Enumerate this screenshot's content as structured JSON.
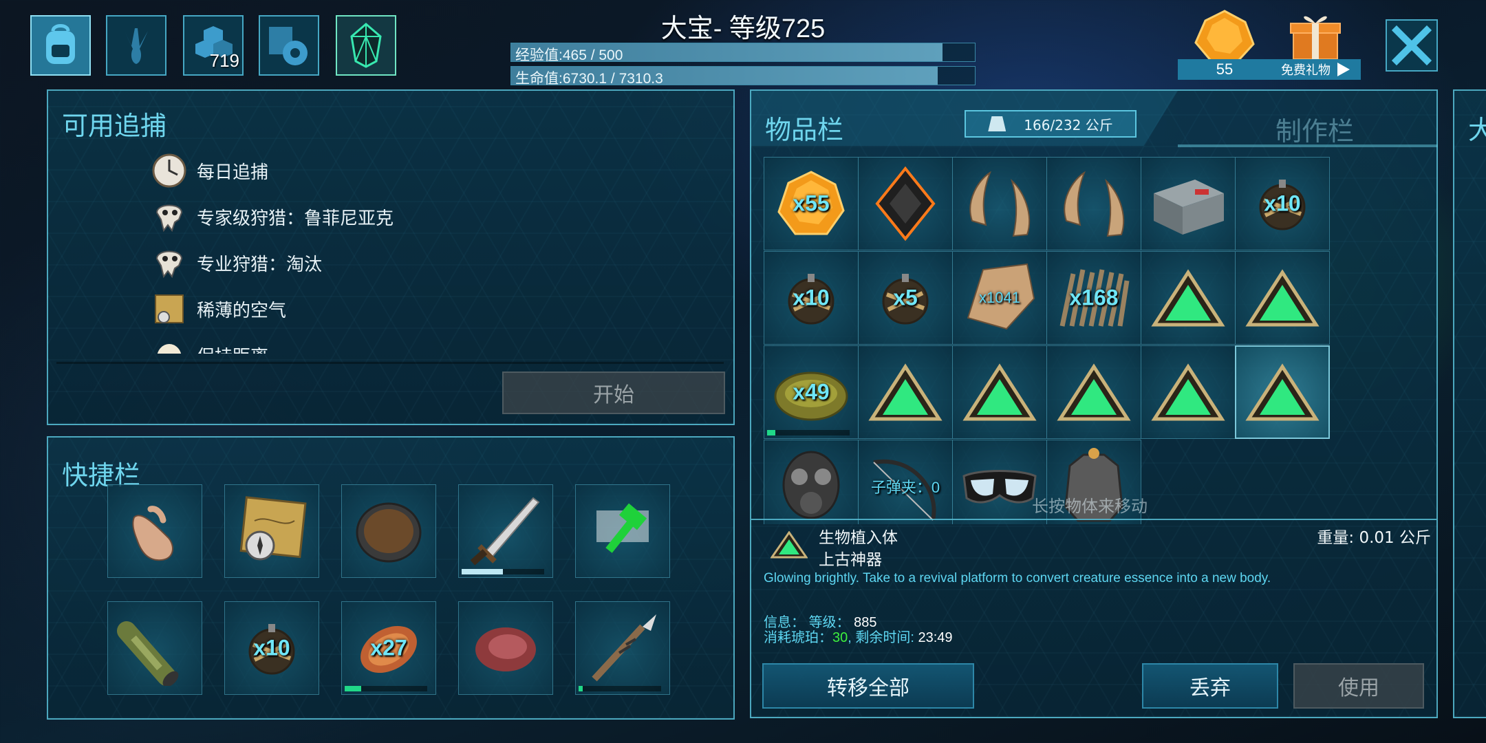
{
  "header": {
    "title": "大宝- 等级725",
    "xp_text": "经验值:465 / 500",
    "xp_fraction": 0.93,
    "health_text": "生命值:6730.1 / 7310.3",
    "health_fraction": 0.92,
    "top_buttons": [
      {
        "icon": "backpack-icon"
      },
      {
        "icon": "dino-footprint-icon"
      },
      {
        "icon": "engrams-icon",
        "label": "719"
      },
      {
        "icon": "settings-book-icon"
      },
      {
        "icon": "element-crystal-icon"
      }
    ],
    "amber_count": "55",
    "gift_label": "免费礼物",
    "close_icon": "close-icon"
  },
  "hunts": {
    "title": "可用追捕",
    "items": [
      {
        "label": "每日追捕",
        "icon": "clock-icon"
      },
      {
        "label": "专家级狩猎：鲁菲尼亚克",
        "icon": "skull-icon"
      },
      {
        "label": "专业狩猎：淘汰",
        "icon": "skull-icon"
      },
      {
        "label": "稀薄的空气",
        "icon": "map-icon"
      },
      {
        "label": "保持距离",
        "icon": "egg-icon"
      }
    ],
    "start_button": "开始"
  },
  "hotbar": {
    "title": "快捷栏",
    "slots": [
      {
        "icon": "hand-icon",
        "qty": "",
        "durability": null
      },
      {
        "icon": "map-compass-icon",
        "qty": "",
        "durability": null
      },
      {
        "icon": "cooking-pot-icon",
        "qty": "",
        "durability": null
      },
      {
        "icon": "sword-icon",
        "qty": "",
        "durability": 0.5
      },
      {
        "icon": "build-hammer-icon",
        "qty": "",
        "durability": null
      },
      {
        "icon": "spyglass-icon",
        "qty": "",
        "durability": null
      },
      {
        "icon": "grenade-icon",
        "qty": "x10",
        "durability": null
      },
      {
        "icon": "cooked-meat-icon",
        "qty": "x27",
        "durability": 0.2
      },
      {
        "icon": "raw-meat-icon",
        "qty": "",
        "durability": null
      },
      {
        "icon": "spear-icon",
        "qty": "",
        "durability": 0.05
      }
    ]
  },
  "inventory": {
    "title": "物品栏",
    "weight": "166/232 公斤",
    "craft_tab": "制作栏",
    "side_tab_partial": "大",
    "slots": [
      {
        "icon": "amber-icon",
        "qty": "x55",
        "durability": null,
        "selected": false
      },
      {
        "icon": "implant-frame-icon",
        "qty": "",
        "durability": null,
        "selected": false
      },
      {
        "icon": "horn-icon",
        "qty": "",
        "durability": null,
        "selected": false
      },
      {
        "icon": "horn-icon",
        "qty": "",
        "durability": null,
        "selected": false
      },
      {
        "icon": "workbench-icon",
        "qty": "",
        "durability": null,
        "selected": false
      },
      {
        "icon": "grenade-icon",
        "qty": "x10",
        "durability": null,
        "selected": false
      },
      {
        "icon": "grenade-icon",
        "qty": "x10",
        "durability": null,
        "selected": false
      },
      {
        "icon": "grenade-icon",
        "qty": "x5",
        "durability": null,
        "selected": false
      },
      {
        "icon": "hide-icon",
        "qty": "x1041",
        "durability": null,
        "selected": false
      },
      {
        "icon": "thatch-icon",
        "qty": "x168",
        "durability": null,
        "selected": false
      },
      {
        "icon": "implant-icon",
        "qty": "",
        "durability": null,
        "selected": false
      },
      {
        "icon": "implant-icon",
        "qty": "",
        "durability": null,
        "selected": false
      },
      {
        "icon": "nest-icon",
        "qty": "x49",
        "durability": 0.1,
        "selected": false
      },
      {
        "icon": "implant-icon",
        "qty": "",
        "durability": null,
        "selected": false
      },
      {
        "icon": "implant-icon",
        "qty": "",
        "durability": null,
        "selected": false
      },
      {
        "icon": "implant-icon",
        "qty": "",
        "durability": null,
        "selected": false
      },
      {
        "icon": "implant-icon",
        "qty": "",
        "durability": null,
        "selected": false
      },
      {
        "icon": "implant-icon",
        "qty": "",
        "durability": null,
        "selected": true
      },
      {
        "icon": "gas-mask-icon",
        "qty": "",
        "durability": null,
        "selected": false
      },
      {
        "icon": "bow-icon",
        "qty": "子弹夹：0",
        "durability": null,
        "selected": false
      },
      {
        "icon": "goggles-icon",
        "qty": "",
        "durability": null,
        "selected": false
      },
      {
        "icon": "chest-armor-icon",
        "qty": "",
        "durability": null,
        "selected": false
      }
    ],
    "drag_hint": "长按物体来移动",
    "detail": {
      "name": "生物植入体",
      "rarity": "上古神器",
      "weight": "重量: 0.01 公斤",
      "description": "Glowing brightly. Take to a revival platform to convert creature essence into a new body.",
      "info_label": "信息：",
      "level_label": "等级：",
      "level_value": "885",
      "amber_label": "消耗琥珀：",
      "amber_value": "30",
      "time_label": ", 剩余时间: ",
      "time_value": "23:49"
    },
    "buttons": {
      "transfer_all": "转移全部",
      "drop": "丢弃",
      "use": "使用"
    }
  }
}
